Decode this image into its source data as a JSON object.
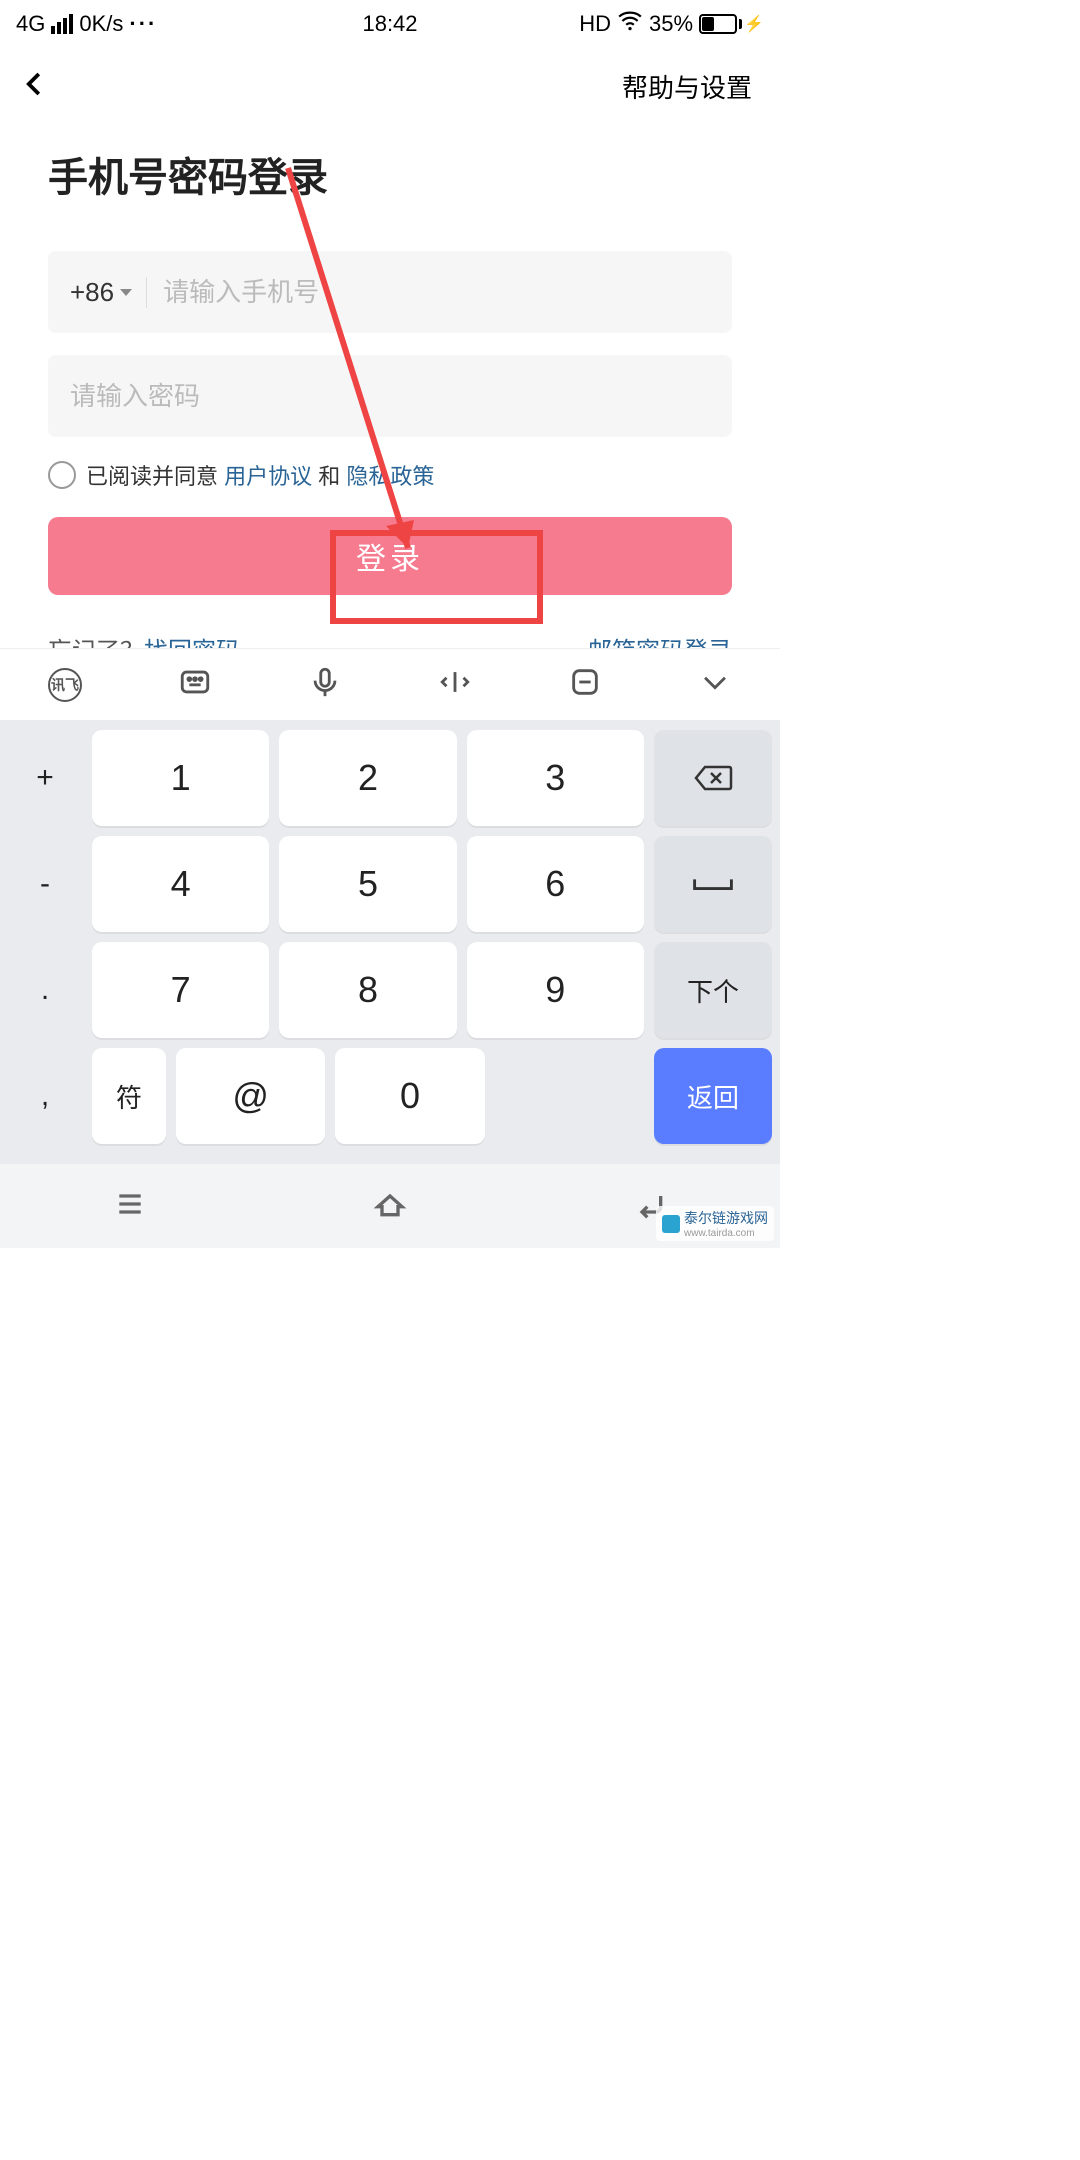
{
  "status": {
    "network": "4G",
    "speed": "0K/s",
    "time": "18:42",
    "hd": "HD",
    "battery_pct": "35%"
  },
  "header": {
    "help_settings": "帮助与设置"
  },
  "login": {
    "title": "手机号密码登录",
    "country_code": "+86",
    "phone_placeholder": "请输入手机号",
    "password_placeholder": "请输入密码",
    "agree_prefix": "已阅读并同意",
    "user_agreement": "用户协议",
    "and": "和",
    "privacy_policy": "隐私政策",
    "login_btn": "登录",
    "forgot_prefix": "忘记了？",
    "recover_password": "找回密码",
    "email_login": "邮箱密码登录"
  },
  "keyboard": {
    "toolbar_xf": "讯飞",
    "side_plus": "+",
    "side_minus": "-",
    "side_dot": ".",
    "side_comma": ",",
    "k1": "1",
    "k2": "2",
    "k3": "3",
    "k4": "4",
    "k5": "5",
    "k6": "6",
    "k7": "7",
    "k8": "8",
    "k9": "9",
    "k0": "0",
    "at": "@",
    "sym": "符",
    "next": "下个",
    "return": "返回"
  },
  "watermark": {
    "name": "泰尔链游戏网",
    "url": "www.tairda.com"
  }
}
